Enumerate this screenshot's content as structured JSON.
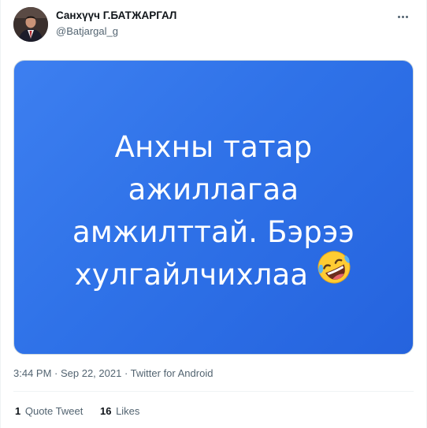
{
  "author": {
    "display_name": "Санхүүч Г.БАТЖАРГАЛ",
    "handle": "@Batjargal_g"
  },
  "media": {
    "text_lines": [
      "Анхны татар",
      "ажиллагаа",
      "амжилттай. Бэрээ",
      "хулгайлчихлаа"
    ],
    "emoji": "rolling-on-floor-laughing-emoji",
    "background_color": "#2f72e8"
  },
  "meta": {
    "time": "3:44 PM",
    "sep1": " · ",
    "date": "Sep 22, 2021",
    "sep2": " · ",
    "source": "Twitter for Android"
  },
  "stats": {
    "quote_count": "1",
    "quote_label": "Quote Tweet",
    "like_count": "16",
    "like_label": "Likes"
  }
}
